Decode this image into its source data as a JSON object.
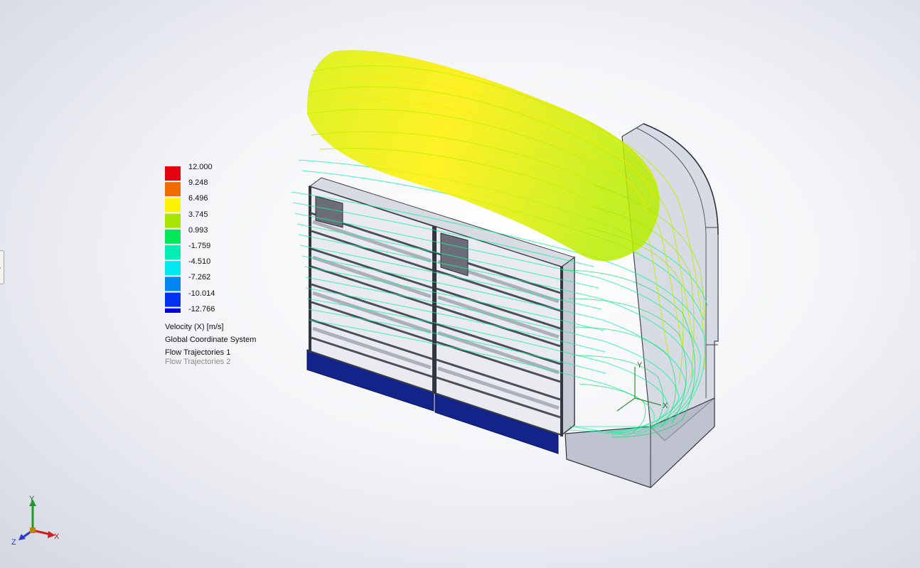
{
  "legend": {
    "ticks": [
      "12.000",
      "9.248",
      "6.496",
      "3.745",
      "0.993",
      "-1.759",
      "-4.510",
      "-7.262",
      "-10.014",
      "-12.766"
    ],
    "colors": [
      "#e3000f",
      "#f06a00",
      "#fff200",
      "#a7e400",
      "#00e85a",
      "#00f0b4",
      "#00e8f0",
      "#0086f0",
      "#0032f0",
      "#0000dc"
    ],
    "quantity": "Velocity (X) [m/s]",
    "coordinate_system": "Global Coordinate System",
    "plots": [
      "Flow Trajectories 1",
      "Flow Trajectories 2"
    ]
  },
  "triad": {
    "x": "X",
    "y": "Y",
    "z": "Z"
  },
  "model_triad": {
    "x": "X",
    "y": "Y"
  },
  "side_tab": {
    "glyph": "›"
  }
}
